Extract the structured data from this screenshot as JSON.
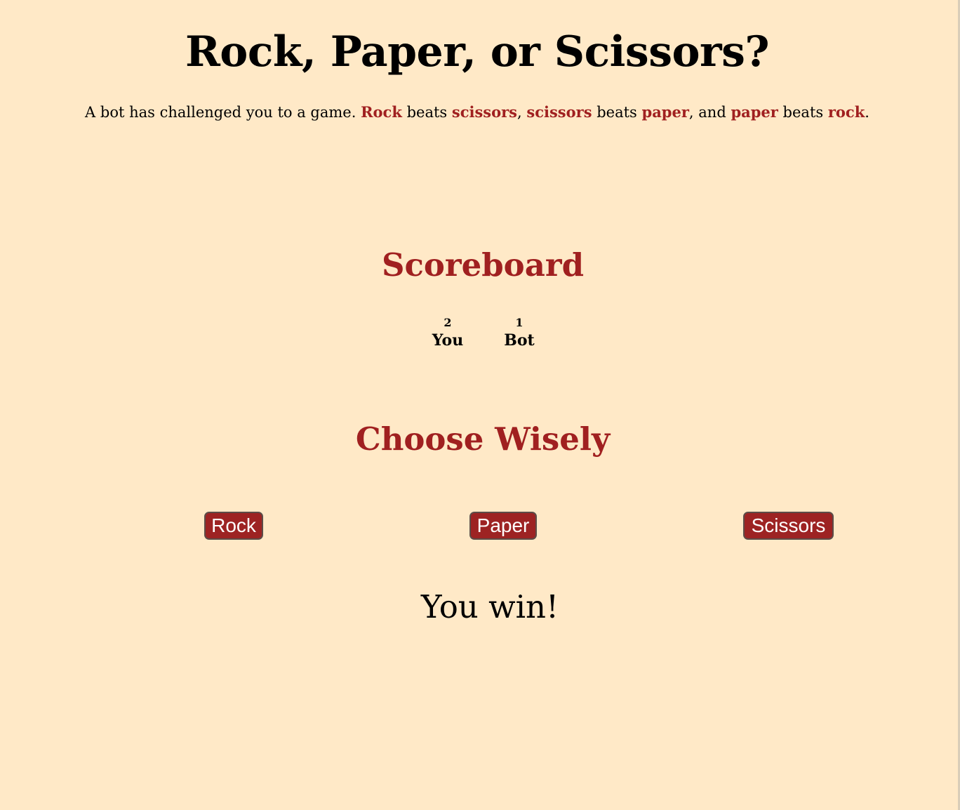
{
  "header": {
    "title": "Rock, Paper, or Scissors?"
  },
  "intro": {
    "text_1": "A bot has challenged you to a game.",
    "rock": "Rock",
    "text_2": "beats",
    "scissors_1": "scissors",
    "scissors_2": "scissors",
    "text_3": "beats",
    "paper_1": "paper",
    "text_4": ", and",
    "paper_2": "paper",
    "text_5": "beats",
    "rock_2": "rock",
    "period": ".",
    "comma": ","
  },
  "scoreboard": {
    "title": "Scoreboard",
    "you": {
      "score": "2",
      "label": "You"
    },
    "bot": {
      "score": "1",
      "label": "Bot"
    }
  },
  "choices": {
    "title": "Choose Wisely",
    "buttons": [
      {
        "label": "Rock"
      },
      {
        "label": "Paper"
      },
      {
        "label": "Scissors"
      }
    ]
  },
  "result": {
    "text": "You win!"
  },
  "colors": {
    "background": "#ffe9c7",
    "accent": "#a02020",
    "button": "#9d2323"
  }
}
